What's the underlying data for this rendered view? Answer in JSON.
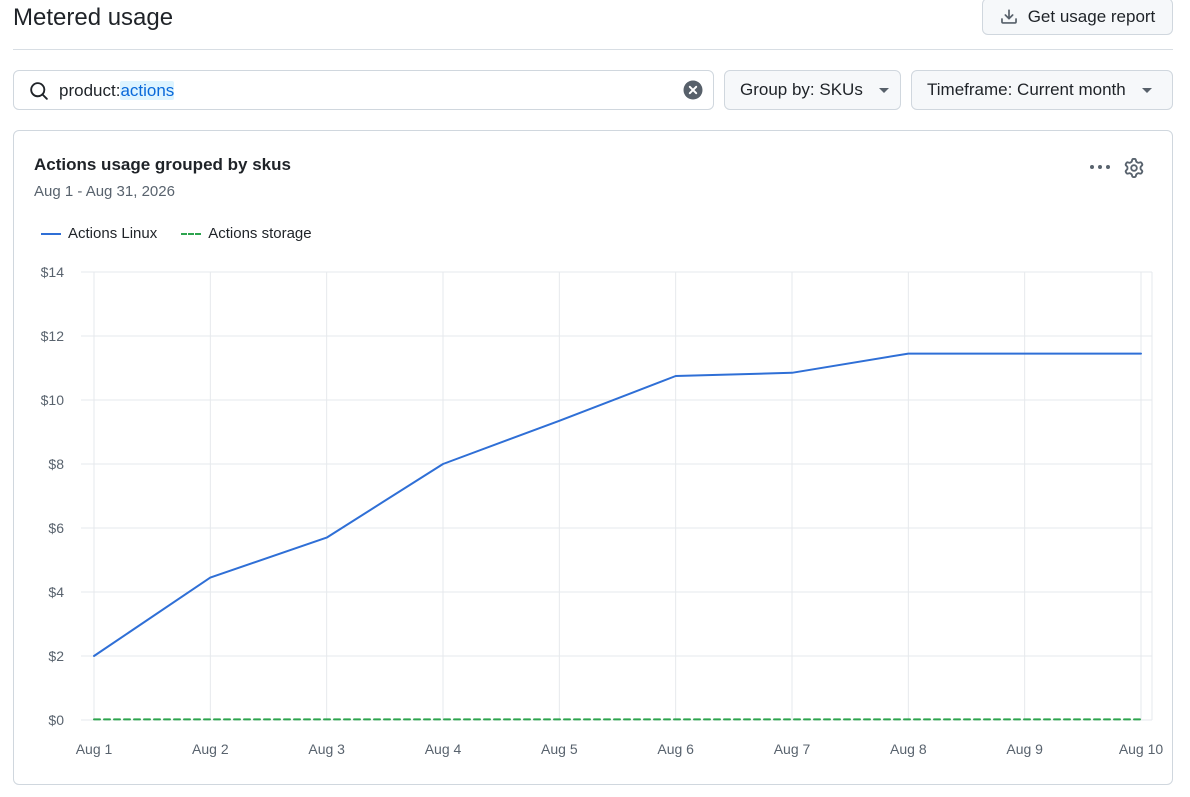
{
  "header": {
    "title": "Metered usage",
    "report_button_label": "Get usage report"
  },
  "filters": {
    "search_prefix": "product:",
    "search_value": "actions",
    "group_by_label": "Group by: SKUs",
    "timeframe_label": "Timeframe: Current month"
  },
  "card": {
    "title": "Actions usage grouped by skus",
    "subtitle": "Aug 1 - Aug 31, 2026"
  },
  "chart_data": {
    "type": "line",
    "title": "Actions usage grouped by skus",
    "subtitle": "Aug 1 - Aug 31, 2026",
    "xlabel": "",
    "ylabel": "",
    "categories": [
      "Aug 1",
      "Aug 2",
      "Aug 3",
      "Aug 4",
      "Aug 5",
      "Aug 6",
      "Aug 7",
      "Aug 8",
      "Aug 9",
      "Aug 10"
    ],
    "y_ticks": [
      "$0",
      "$2",
      "$4",
      "$6",
      "$8",
      "$10",
      "$12",
      "$14"
    ],
    "ylim": [
      0,
      14
    ],
    "grid": true,
    "legend_position": "top-left",
    "series": [
      {
        "name": "Actions Linux",
        "color": "#2f6fd6",
        "dash": "solid",
        "values": [
          2.0,
          4.45,
          5.7,
          8.0,
          9.35,
          10.75,
          10.85,
          11.45,
          11.45,
          11.45
        ]
      },
      {
        "name": "Actions storage",
        "color": "#2da44e",
        "dash": "dashed",
        "values": [
          0.02,
          0.02,
          0.02,
          0.02,
          0.02,
          0.02,
          0.02,
          0.02,
          0.02,
          0.02
        ]
      }
    ]
  }
}
